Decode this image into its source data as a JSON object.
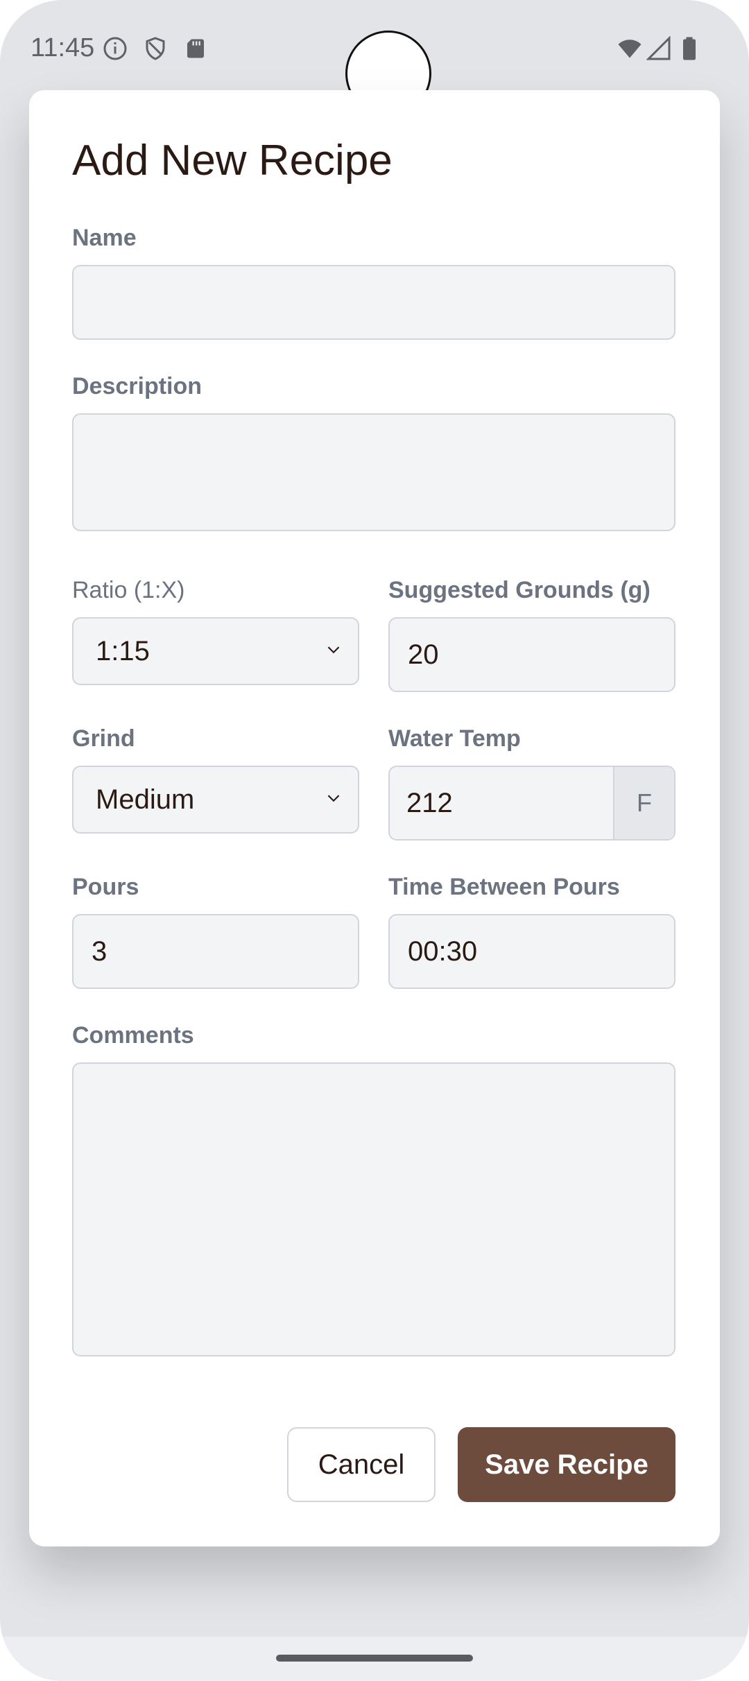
{
  "status_bar": {
    "time": "11:45",
    "icons_left": [
      "info-icon",
      "shield-icon",
      "sd-card-icon"
    ],
    "icons_right": [
      "wifi-icon",
      "signal-icon",
      "battery-icon"
    ]
  },
  "modal": {
    "title": "Add New Recipe",
    "name": {
      "label": "Name",
      "value": ""
    },
    "description": {
      "label": "Description",
      "value": ""
    },
    "ratio": {
      "label": "Ratio (1:X)",
      "value": "1:15"
    },
    "suggested_grounds": {
      "label": "Suggested Grounds (g)",
      "value": "20"
    },
    "grind": {
      "label": "Grind",
      "value": "Medium"
    },
    "water_temp": {
      "label": "Water Temp",
      "value": "212",
      "unit": "F"
    },
    "pours": {
      "label": "Pours",
      "value": "3"
    },
    "time_between_pours": {
      "label": "Time Between Pours",
      "value": "00:30"
    },
    "comments": {
      "label": "Comments",
      "value": ""
    },
    "buttons": {
      "cancel": "Cancel",
      "save": "Save Recipe"
    }
  },
  "colors": {
    "accent": "#6d4c3d",
    "field_bg": "#f3f4f6",
    "label": "#6b7280",
    "title": "#2b1a14"
  }
}
